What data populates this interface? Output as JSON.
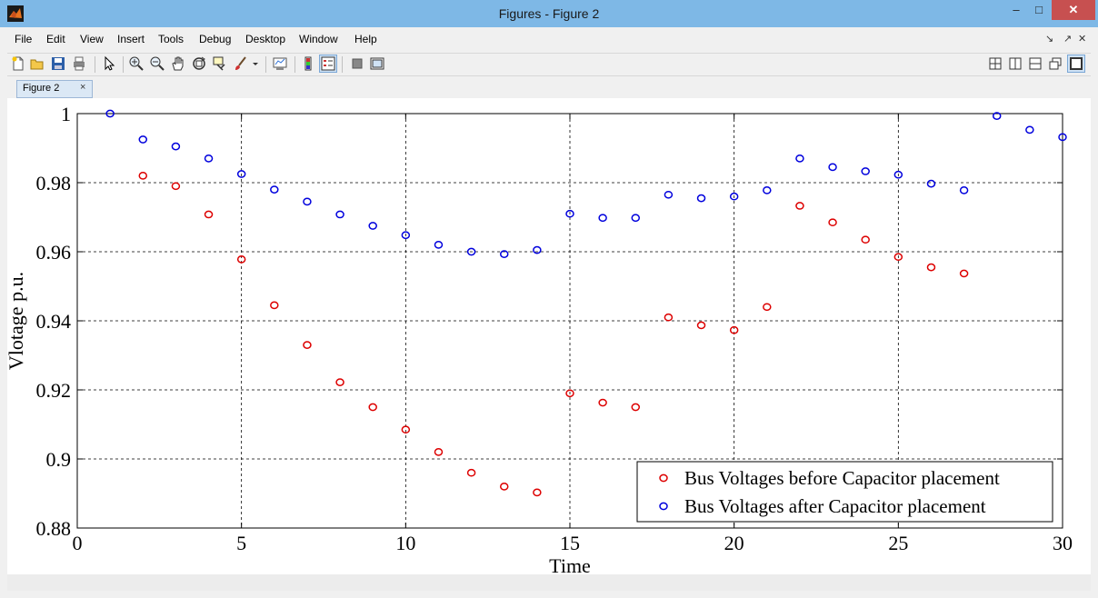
{
  "window": {
    "title": "Figures - Figure 2",
    "controls": {
      "minimize": "–",
      "maximize": "□",
      "close": "✕"
    }
  },
  "menu": [
    "File",
    "Edit",
    "View",
    "Insert",
    "Tools",
    "Debug",
    "Desktop",
    "Window",
    "Help"
  ],
  "menu_right": [
    "↘",
    "↗",
    "✕"
  ],
  "toolbar": {
    "left_icons": [
      "new-figure-icon",
      "open-file-icon",
      "save-icon",
      "print-icon",
      "edit-plot-icon",
      "zoom-in-icon",
      "zoom-out-icon",
      "pan-icon",
      "rotate-3d-icon",
      "data-cursor-icon",
      "brush-icon",
      "brush-dropdown-icon",
      "link-plot-icon",
      "colorbar-icon",
      "legend-icon",
      "hide-plot-tools-icon",
      "show-plot-tools-icon"
    ],
    "right_icons": [
      "tile-layout-icon",
      "left-right-layout-icon",
      "top-bottom-layout-icon",
      "float-icon",
      "maximize-layout-icon"
    ]
  },
  "tabs": [
    {
      "label": "Figure 2",
      "close": "×"
    }
  ],
  "chart_data": {
    "type": "scatter",
    "title": "",
    "xlabel": "Time",
    "ylabel": "Vlotage p.u.",
    "xlim": [
      0,
      30
    ],
    "ylim": [
      0.88,
      1.0
    ],
    "xticks": [
      0,
      5,
      10,
      15,
      20,
      25,
      30
    ],
    "yticks": [
      0.88,
      0.9,
      0.92,
      0.94,
      0.96,
      0.98,
      1
    ],
    "ytick_labels": [
      "0.88",
      "0.9",
      "0.92",
      "0.94",
      "0.96",
      "0.98",
      "1"
    ],
    "grid": true,
    "legend_position": "bottom-right",
    "series": [
      {
        "name": "Bus Voltages before Capacitor placement",
        "color": "#dd0000",
        "marker": "circle",
        "x": [
          2,
          3,
          4,
          5,
          6,
          7,
          8,
          9,
          10,
          11,
          12,
          13,
          14,
          15,
          16,
          17,
          18,
          19,
          20,
          21,
          22,
          23,
          24,
          25,
          26,
          27
        ],
        "y": [
          0.982,
          0.979,
          0.9708,
          0.9578,
          0.9445,
          0.933,
          0.9222,
          0.915,
          0.9085,
          0.902,
          0.896,
          0.892,
          0.8903,
          0.919,
          0.9163,
          0.915,
          0.941,
          0.9387,
          0.9373,
          0.944,
          0.9733,
          0.9685,
          0.9635,
          0.9585,
          0.9555,
          0.9537
        ]
      },
      {
        "name": "Bus Voltages after Capacitor placement",
        "color": "#0000dd",
        "marker": "circle",
        "x": [
          1,
          2,
          3,
          4,
          5,
          6,
          7,
          8,
          9,
          10,
          11,
          12,
          13,
          14,
          15,
          16,
          17,
          18,
          19,
          20,
          21,
          22,
          23,
          24,
          25,
          26,
          27,
          28,
          29,
          30
        ],
        "y": [
          1.0,
          0.9925,
          0.9905,
          0.987,
          0.9825,
          0.978,
          0.9745,
          0.9708,
          0.9675,
          0.9648,
          0.962,
          0.96,
          0.9593,
          0.9605,
          0.971,
          0.9698,
          0.9698,
          0.9765,
          0.9755,
          0.976,
          0.9778,
          0.987,
          0.9845,
          0.9833,
          0.9823,
          0.9797,
          0.9778,
          0.9993,
          0.9953,
          0.9932
        ]
      }
    ]
  }
}
